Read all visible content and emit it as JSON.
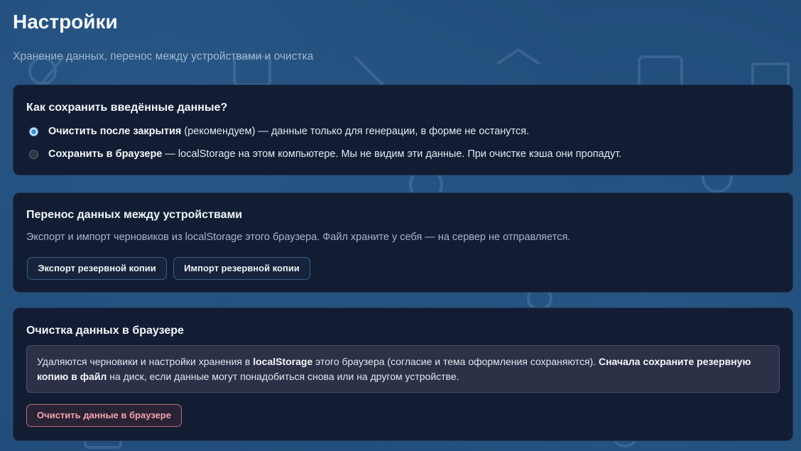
{
  "page": {
    "title": "Настройки",
    "subtitle": "Хранение данных, перенос между устройствами и очистка"
  },
  "storage": {
    "title": "Как сохранить введённые данные?",
    "options": [
      {
        "label_bold": "Очистить после закрытия",
        "label_rest": " (рекомендуем) — данные только для генерации, в форме не останутся.",
        "checked": true
      },
      {
        "label_bold": "Сохранить в браузере",
        "label_rest": " — localStorage на этом компьютере. Мы не видим эти данные. При очистке кэша они пропадут.",
        "checked": false
      }
    ]
  },
  "transfer": {
    "title": "Перенос данных между устройствами",
    "description": "Экспорт и импорт черновиков из localStorage этого браузера. Файл храните у себя — на сервер не отправляется.",
    "export_label": "Экспорт резервной копии",
    "import_label": "Импорт резервной копии"
  },
  "clear": {
    "title": "Очистка данных в браузере",
    "warning": {
      "part1": "Удаляются черновики и настройки хранения в ",
      "part2_bold": "localStorage",
      "part3": " этого браузера (согласие и тема оформления сохраняются). ",
      "part4_bold": "Сначала сохраните резервную копию в файл",
      "part5": " на диск, если данные могут понадобиться снова или на другом устройстве."
    },
    "button_label": "Очистить данные в браузере"
  },
  "colors": {
    "background": "#1f4a78",
    "card": "#121d33",
    "accent": "#3a8ed8",
    "danger": "#f2a3ab"
  }
}
